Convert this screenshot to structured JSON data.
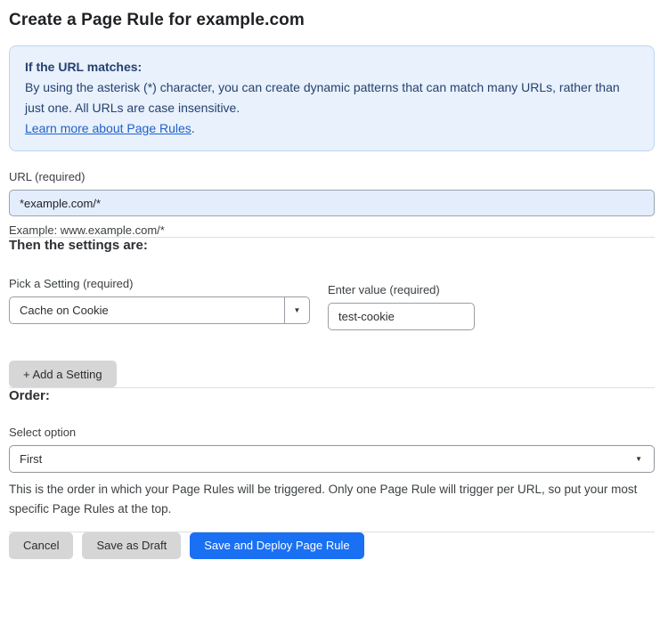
{
  "page": {
    "title": "Create a Page Rule for example.com"
  },
  "info_box": {
    "heading": "If the URL matches:",
    "body": "By using the asterisk (*) character, you can create dynamic patterns that can match many URLs, rather than just one. All URLs are case insensitive.",
    "link_label": "Learn more about Page Rules",
    "link_suffix": "."
  },
  "url_field": {
    "label": "URL (required)",
    "value": "*example.com/*",
    "helper": "Example: www.example.com/*"
  },
  "settings_section": {
    "heading": "Then the settings are:",
    "setting_picker": {
      "label": "Pick a Setting (required)",
      "selected": "Cache on Cookie",
      "arrow_icon": "▼"
    },
    "value_field": {
      "label": "Enter value (required)",
      "value": "test-cookie"
    },
    "add_setting_label": "+ Add a Setting"
  },
  "order_section": {
    "heading": "Order:",
    "select_label": "Select option",
    "selected_option": "First",
    "arrow_icon": "▼",
    "helper": "This is the order in which your Page Rules will be triggered. Only one Page Rule will trigger per URL, so put your most specific Page Rules at the top."
  },
  "actions": {
    "cancel_label": "Cancel",
    "save_draft_label": "Save as Draft",
    "save_deploy_label": "Save and Deploy Page Rule"
  },
  "colors": {
    "accent_blue": "#1a70f2",
    "info_bg": "#e8f1fc",
    "info_border": "#bdd7f1",
    "info_text": "#25416f",
    "link_blue": "#2261c9",
    "url_input_bg": "#e4edfb",
    "button_gray": "#d6d6d6"
  }
}
